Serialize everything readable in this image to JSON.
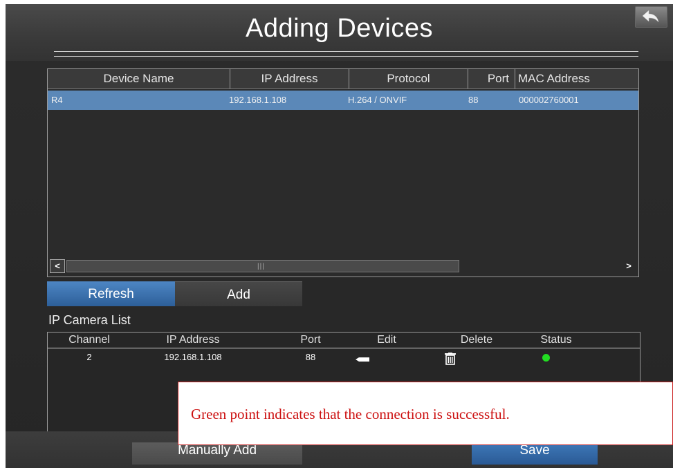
{
  "header": {
    "title": "Adding Devices",
    "back_icon": "back-arrow-icon"
  },
  "device_table": {
    "columns": [
      "Device Name",
      "IP Address",
      "Protocol",
      "Port",
      "MAC Address"
    ],
    "rows": [
      {
        "device_name": "R4",
        "ip_address": "192.168.1.108",
        "protocol": "H.264 / ONVIF",
        "port": "88",
        "mac_address": "000002760001"
      }
    ],
    "selected_row_color": "#5b88b8"
  },
  "tabs": {
    "refresh": "Refresh",
    "add": "Add"
  },
  "ip_camera_list": {
    "label": "IP Camera List",
    "columns": [
      "Channel",
      "IP Address",
      "Port",
      "Edit",
      "Delete",
      "Status"
    ],
    "rows": [
      {
        "channel": "2",
        "ip_address": "192.168.1.108",
        "port": "88",
        "edit_icon": "edit-icon",
        "delete_icon": "trash-icon",
        "status": "connected"
      }
    ],
    "status_color": "#22dd22"
  },
  "footer": {
    "manually_add": "Manually Add",
    "save": "Save"
  },
  "callout": {
    "text": "Green point indicates that the connection is successful.",
    "color": "#cc1111"
  }
}
